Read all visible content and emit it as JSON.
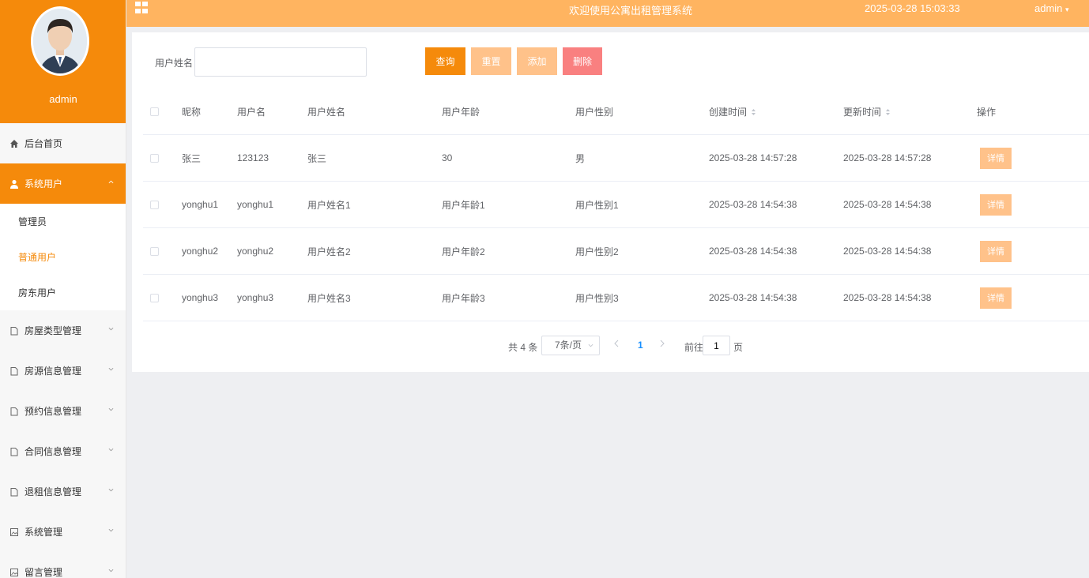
{
  "sidebar": {
    "user_name": "admin",
    "home": "后台首页",
    "system_users": "系统用户",
    "sub_items": [
      "管理员",
      "普通用户",
      "房东用户"
    ],
    "menu": [
      "房屋类型管理",
      "房源信息管理",
      "预约信息管理",
      "合同信息管理",
      "退租信息管理",
      "系统管理",
      "留言管理"
    ]
  },
  "topbar": {
    "title": "欢迎使用公寓出租管理系统",
    "datetime": "2025-03-28 15:03:33",
    "user": "admin"
  },
  "search": {
    "label": "用户姓名",
    "value": "",
    "buttons": {
      "query": "查询",
      "reset": "重置",
      "add": "添加",
      "delete": "删除"
    }
  },
  "table": {
    "headers": [
      "昵称",
      "用户名",
      "用户姓名",
      "用户年龄",
      "用户性别",
      "创建时间",
      "更新时间",
      "操作"
    ],
    "rows": [
      {
        "nickname": "张三",
        "username": "123123",
        "realname": "张三",
        "age": "30",
        "gender": "男",
        "created": "2025-03-28 14:57:28",
        "updated": "2025-03-28 14:57:28",
        "action": "详情"
      },
      {
        "nickname": "yonghu1",
        "username": "yonghu1",
        "realname": "用户姓名1",
        "age": "用户年龄1",
        "gender": "用户性别1",
        "created": "2025-03-28 14:54:38",
        "updated": "2025-03-28 14:54:38",
        "action": "详情"
      },
      {
        "nickname": "yonghu2",
        "username": "yonghu2",
        "realname": "用户姓名2",
        "age": "用户年龄2",
        "gender": "用户性别2",
        "created": "2025-03-28 14:54:38",
        "updated": "2025-03-28 14:54:38",
        "action": "详情"
      },
      {
        "nickname": "yonghu3",
        "username": "yonghu3",
        "realname": "用户姓名3",
        "age": "用户年龄3",
        "gender": "用户性别3",
        "created": "2025-03-28 14:54:38",
        "updated": "2025-03-28 14:54:38",
        "action": "详情"
      }
    ]
  },
  "pagination": {
    "total": "共 4 条",
    "page_size": "7条/页",
    "current": "1",
    "goto_label": "前往",
    "goto_value": "1",
    "page_label": "页"
  },
  "colors": {
    "primary": "#f58a0b",
    "topbar": "#ffb460",
    "light_button": "#ffc28a",
    "danger": "#f98080",
    "link": "#1890ff"
  }
}
